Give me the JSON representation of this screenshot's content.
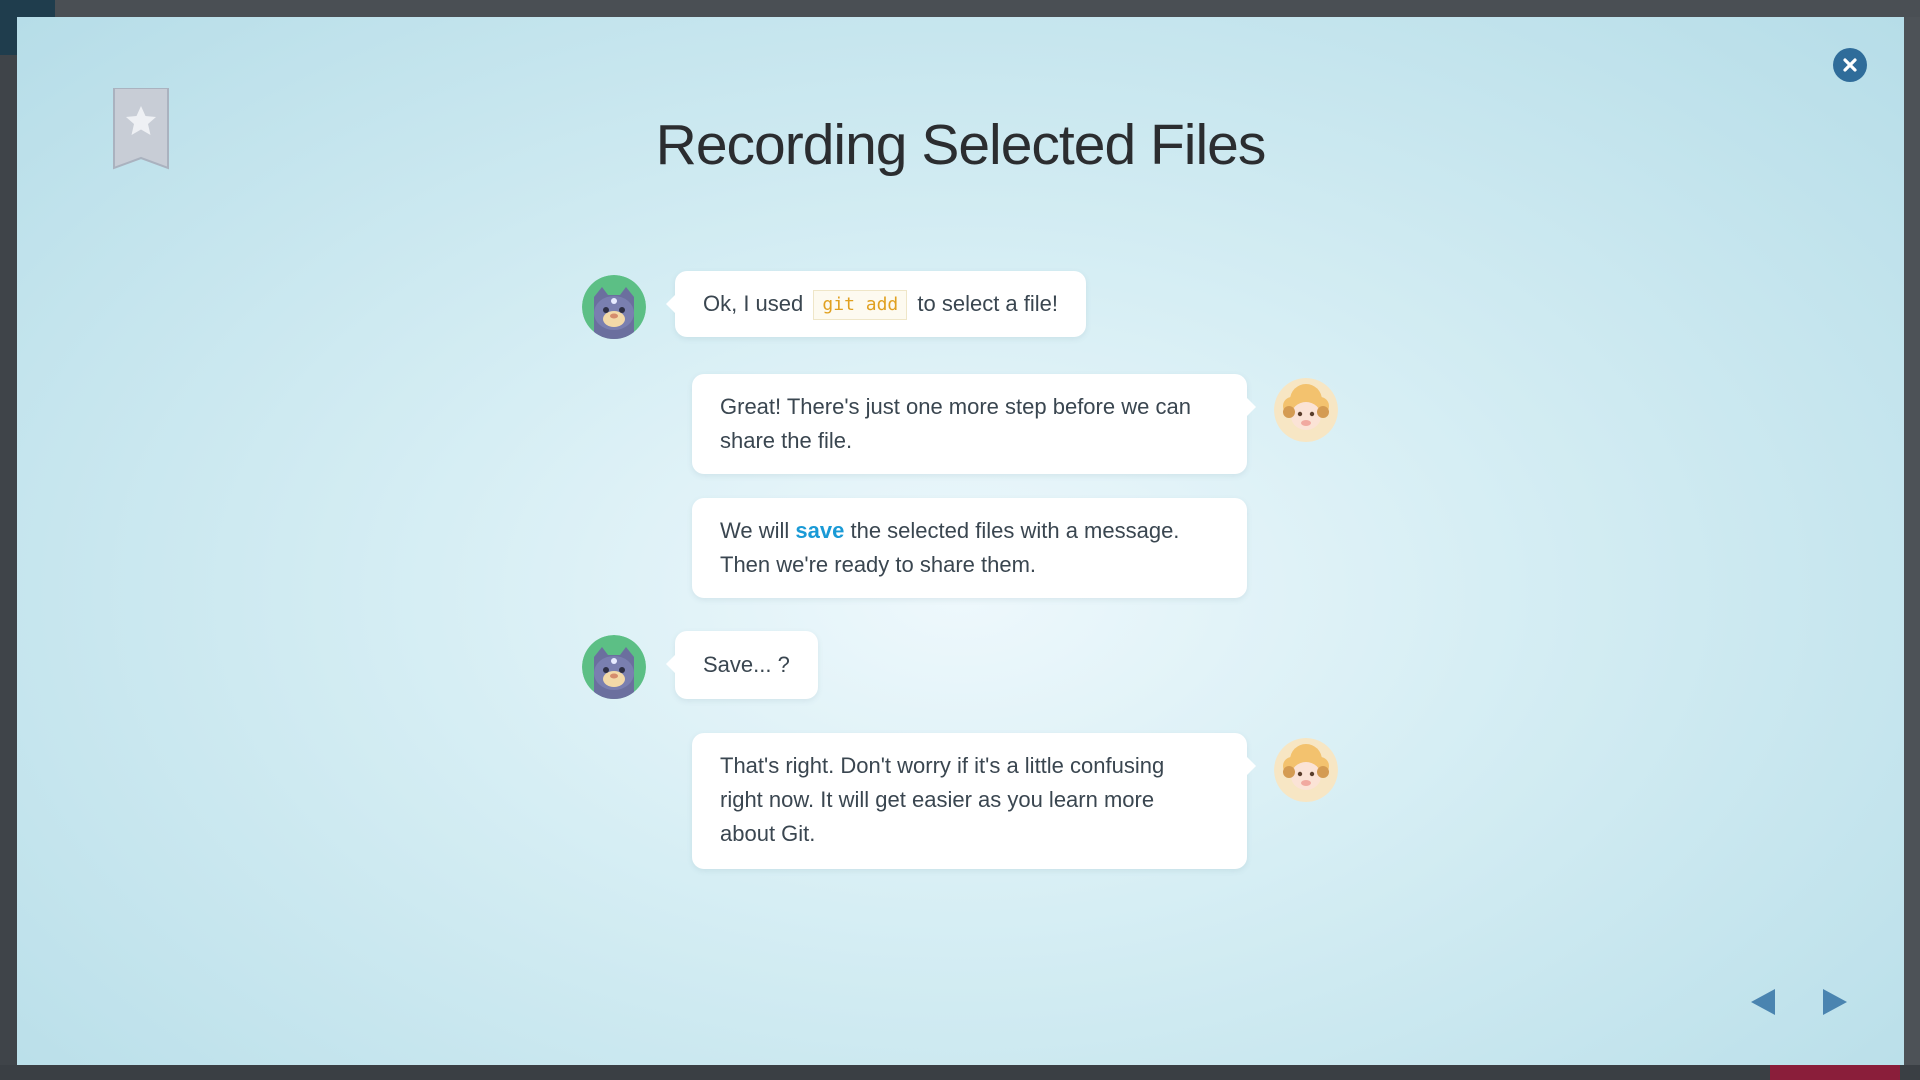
{
  "lesson": {
    "title": "Recording Selected Files"
  },
  "icons": {
    "close": "close-icon",
    "bookmark": "bookmark-star-icon",
    "prev": "triangle-left-icon",
    "next": "triangle-right-icon"
  },
  "colors": {
    "accent": "#2f6c9a",
    "keyword": "#1a9ad6",
    "code": "#e0a020",
    "text": "#3a4650"
  },
  "messages": [
    {
      "speaker": "cat",
      "parts": {
        "before": "Ok, I used",
        "code": "git add",
        "after": "to select a file!"
      }
    },
    {
      "speaker": "sheep",
      "text_line1": "Great! There's just one more step before we can",
      "text_line2": "share the file."
    },
    {
      "speaker": "sheep",
      "parts": {
        "before": "We will",
        "keyword": "save",
        "after": "the selected files with a message."
      },
      "text_line2": "Then we're ready to share them."
    },
    {
      "speaker": "cat",
      "text": "Save... ?"
    },
    {
      "speaker": "sheep",
      "text_line1": "That's right. Don't worry if it's a little confusing",
      "text_line2": "right now. It will get easier as you learn more",
      "text_line3": "about Git."
    }
  ]
}
